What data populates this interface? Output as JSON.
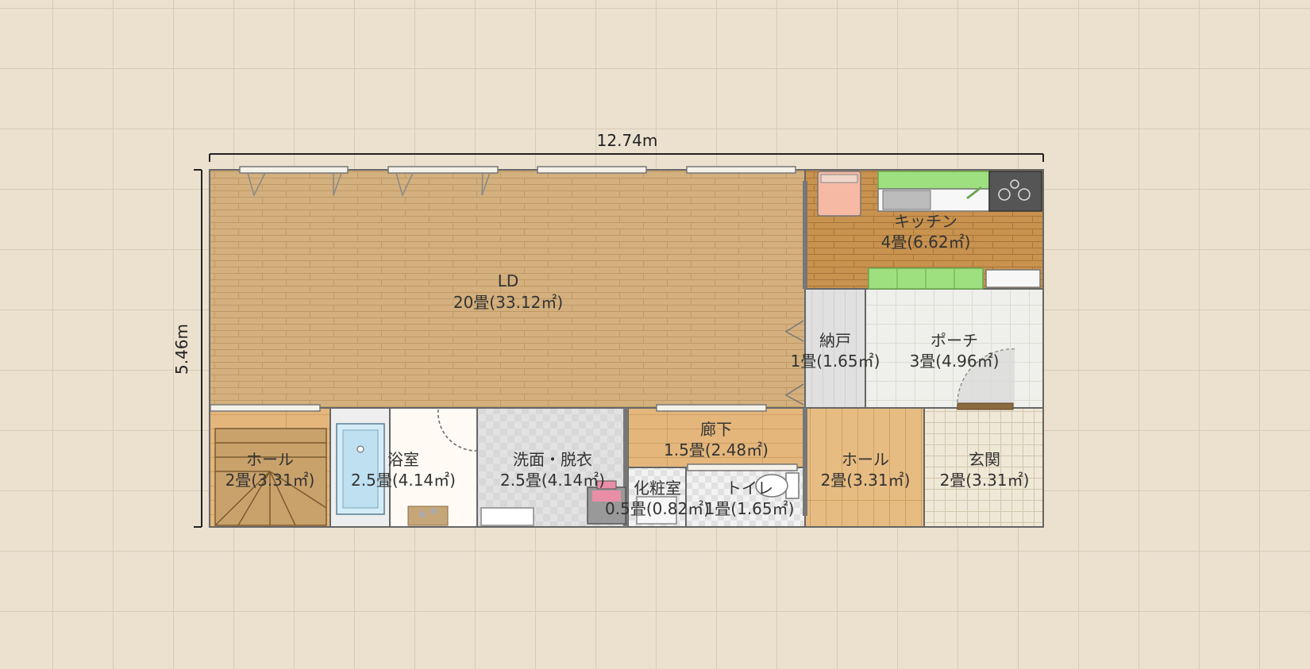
{
  "dimensions": {
    "width_label": "12.74m",
    "height_label": "5.46m"
  },
  "rooms": {
    "ld": {
      "name": "LD",
      "area": "20畳(33.12㎡)"
    },
    "kitchen": {
      "name": "キッチン",
      "area": "4畳(6.62㎡)"
    },
    "storage": {
      "name": "納戸",
      "area": "1畳(1.65㎡)"
    },
    "porch": {
      "name": "ポーチ",
      "area": "3畳(4.96㎡)"
    },
    "hall_left": {
      "name": "ホール",
      "area": "2畳(3.31㎡)"
    },
    "bath": {
      "name": "浴室",
      "area": "2.5畳(4.14㎡)"
    },
    "washroom": {
      "name": "洗面・脱衣",
      "area": "2.5畳(4.14㎡)"
    },
    "corridor": {
      "name": "廊下",
      "area": "1.5畳(2.48㎡)"
    },
    "powder": {
      "name": "化粧室",
      "area": "0.5畳(0.82㎡)"
    },
    "toilet": {
      "name": "トイレ",
      "area": "1畳(1.65㎡)"
    },
    "hall_right": {
      "name": "ホール",
      "area": "2畳(3.31㎡)"
    },
    "entrance": {
      "name": "玄関",
      "area": "2畳(3.31㎡)"
    }
  },
  "colors": {
    "background": "#ece1cf",
    "grid": "#d8cab4",
    "ld_floor": "#d4b07e",
    "kitchen_floor": "#c8924f",
    "hall_floor": "#e7bc82",
    "tile_floor": "#eeeeea",
    "wall": "#666666"
  }
}
